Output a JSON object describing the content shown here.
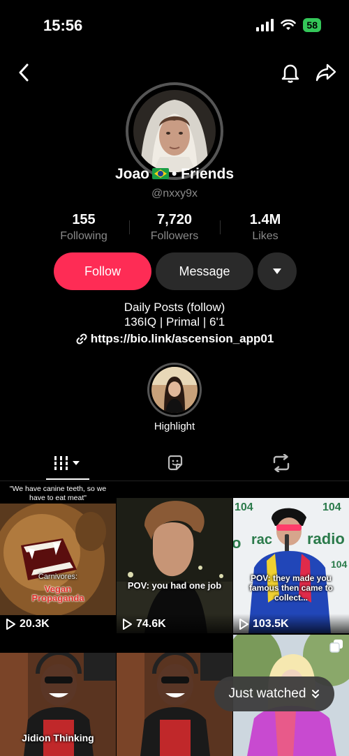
{
  "status": {
    "time": "15:56",
    "battery": "58"
  },
  "profile": {
    "name_prefix": "Joao",
    "name_suffix": "• Friends",
    "handle": "@nxxy9x"
  },
  "stats": [
    {
      "value": "155",
      "label": "Following"
    },
    {
      "value": "7,720",
      "label": "Followers"
    },
    {
      "value": "1.4M",
      "label": "Likes"
    }
  ],
  "actions": {
    "follow": "Follow",
    "message": "Message"
  },
  "bio": {
    "line1": "Daily Posts (follow)",
    "line2": "136IQ | Primal | 6'1",
    "link": "https://bio.link/ascension_app01"
  },
  "highlight": {
    "label": "Highlight"
  },
  "videos": [
    {
      "top_text": "\"We have canine teeth, so we have to eat meat\"",
      "caption_a": "Carnivores:",
      "caption_b": "Vegan Propaganda",
      "views": "20.3K"
    },
    {
      "caption": "POV: you had one job",
      "views": "74.6K"
    },
    {
      "caption": "POV: they made you famous then came to collect...",
      "views": "103.5K"
    },
    {
      "caption": "Jidion Thinking"
    },
    {
      "caption": ""
    },
    {
      "caption": ""
    }
  ],
  "just_watched": "Just watched",
  "colors": {
    "follow": "#fe2c55",
    "secondary_button": "#2a2a2a",
    "muted_text": "#8a8a8a"
  }
}
